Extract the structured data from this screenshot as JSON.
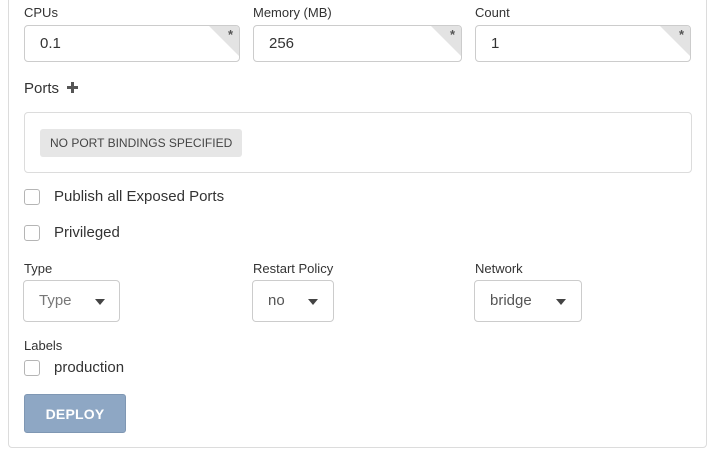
{
  "resources": {
    "cpus_label": "CPUs",
    "cpus_value": "0.1",
    "memory_label": "Memory (MB)",
    "memory_value": "256",
    "count_label": "Count",
    "count_value": "1",
    "required_marker": "*"
  },
  "ports": {
    "title": "Ports",
    "empty_text": "NO PORT BINDINGS SPECIFIED"
  },
  "options": {
    "publish_all_label": "Publish all Exposed Ports",
    "publish_all_checked": false,
    "privileged_label": "Privileged",
    "privileged_checked": false
  },
  "selects": {
    "type_label": "Type",
    "type_value": "Type",
    "restart_label": "Restart Policy",
    "restart_value": "no",
    "network_label": "Network",
    "network_value": "bridge"
  },
  "labels": {
    "title": "Labels",
    "items": [
      {
        "label": "production",
        "checked": false
      }
    ]
  },
  "actions": {
    "deploy_label": "DEPLOY"
  },
  "colors": {
    "deploy_button": "#8ea7c4",
    "border": "#cccccc"
  }
}
